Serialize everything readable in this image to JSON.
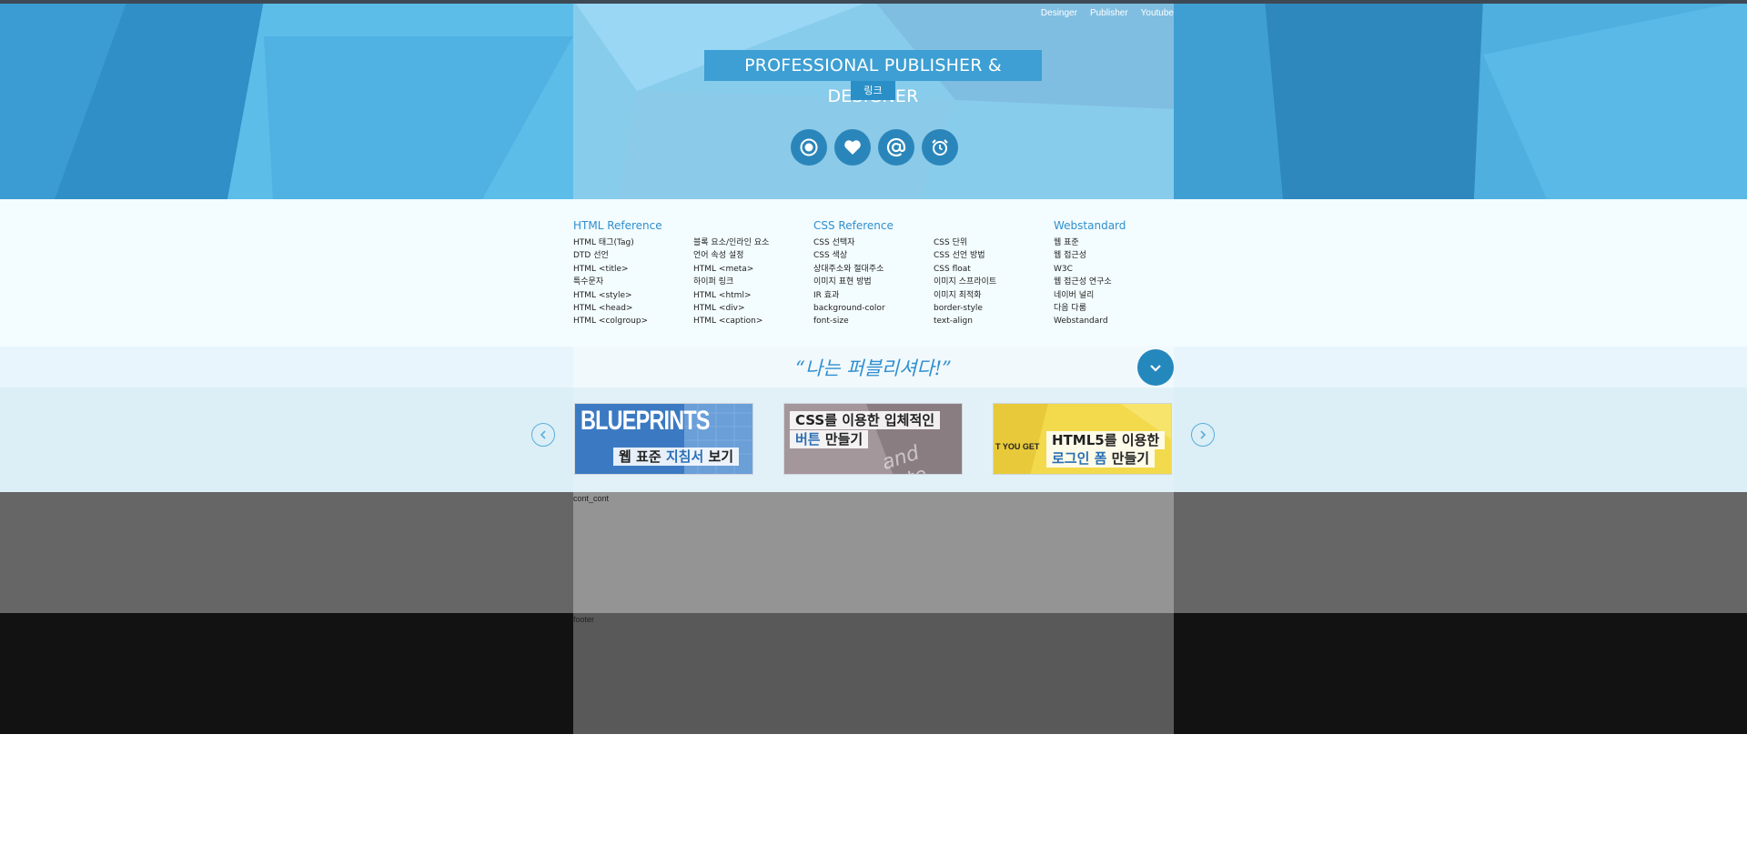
{
  "header": {
    "nav": [
      "Desinger",
      "Publisher",
      "Youtube"
    ],
    "title": "PROFESSIONAL PUBLISHER & DESIGNER",
    "link_badge": "링크",
    "icons": [
      "record-icon",
      "heart-icon",
      "at-icon",
      "alarm-icon"
    ]
  },
  "references": [
    {
      "title": "HTML Reference",
      "columns": [
        [
          "HTML 태그(Tag)",
          "DTD 선언",
          "HTML <title>",
          "특수문자",
          "HTML <style>",
          "HTML <head>",
          "HTML <colgroup>"
        ],
        [
          "블록 요소/인라인 요소",
          "언어 속성 설정",
          "HTML <meta>",
          "하이퍼 링크",
          "HTML <html>",
          "HTML <div>",
          "HTML <caption>"
        ]
      ]
    },
    {
      "title": "CSS Reference",
      "columns": [
        [
          "CSS 선택자",
          "CSS 색상",
          "상대주소와 절대주소",
          "이미지 표현 방법",
          "IR 효과",
          "background-color",
          "font-size"
        ],
        [
          "CSS 단위",
          "CSS 선언 방법",
          "CSS float",
          "이미지 스프라이트",
          "이미지 최적화",
          "border-style",
          "text-align"
        ]
      ]
    },
    {
      "title": "Webstandard",
      "columns": [
        [
          "웹 표준",
          "웹 접근성",
          "W3C",
          "웹 접근성 연구소",
          "네이버 널리",
          "다음 다룸",
          "Webstandard"
        ]
      ]
    }
  ],
  "slogan": "“나는 퍼블리셔다!”",
  "banners": [
    {
      "big": "BLUEPRINTS",
      "caption_pre": "웹 표준 ",
      "caption_hl": "지침서",
      "caption_post": " 보기"
    },
    {
      "line1": "CSS를 이용한 입체적인",
      "line2_hl": "버튼",
      "line2_post": " 만들기",
      "bg_text": "and inte"
    },
    {
      "side": "T YOU GET",
      "line1": "HTML5를 이용한",
      "line2_hl": "로그인 폼",
      "line2_post": " 만들기"
    }
  ],
  "content_label": "cont_cont",
  "footer_label": "footer",
  "colors": {
    "accent": "#2f8fce",
    "header_bg": "#3aa6dc",
    "content_bg": "#666666",
    "footer_bg": "#121212"
  }
}
